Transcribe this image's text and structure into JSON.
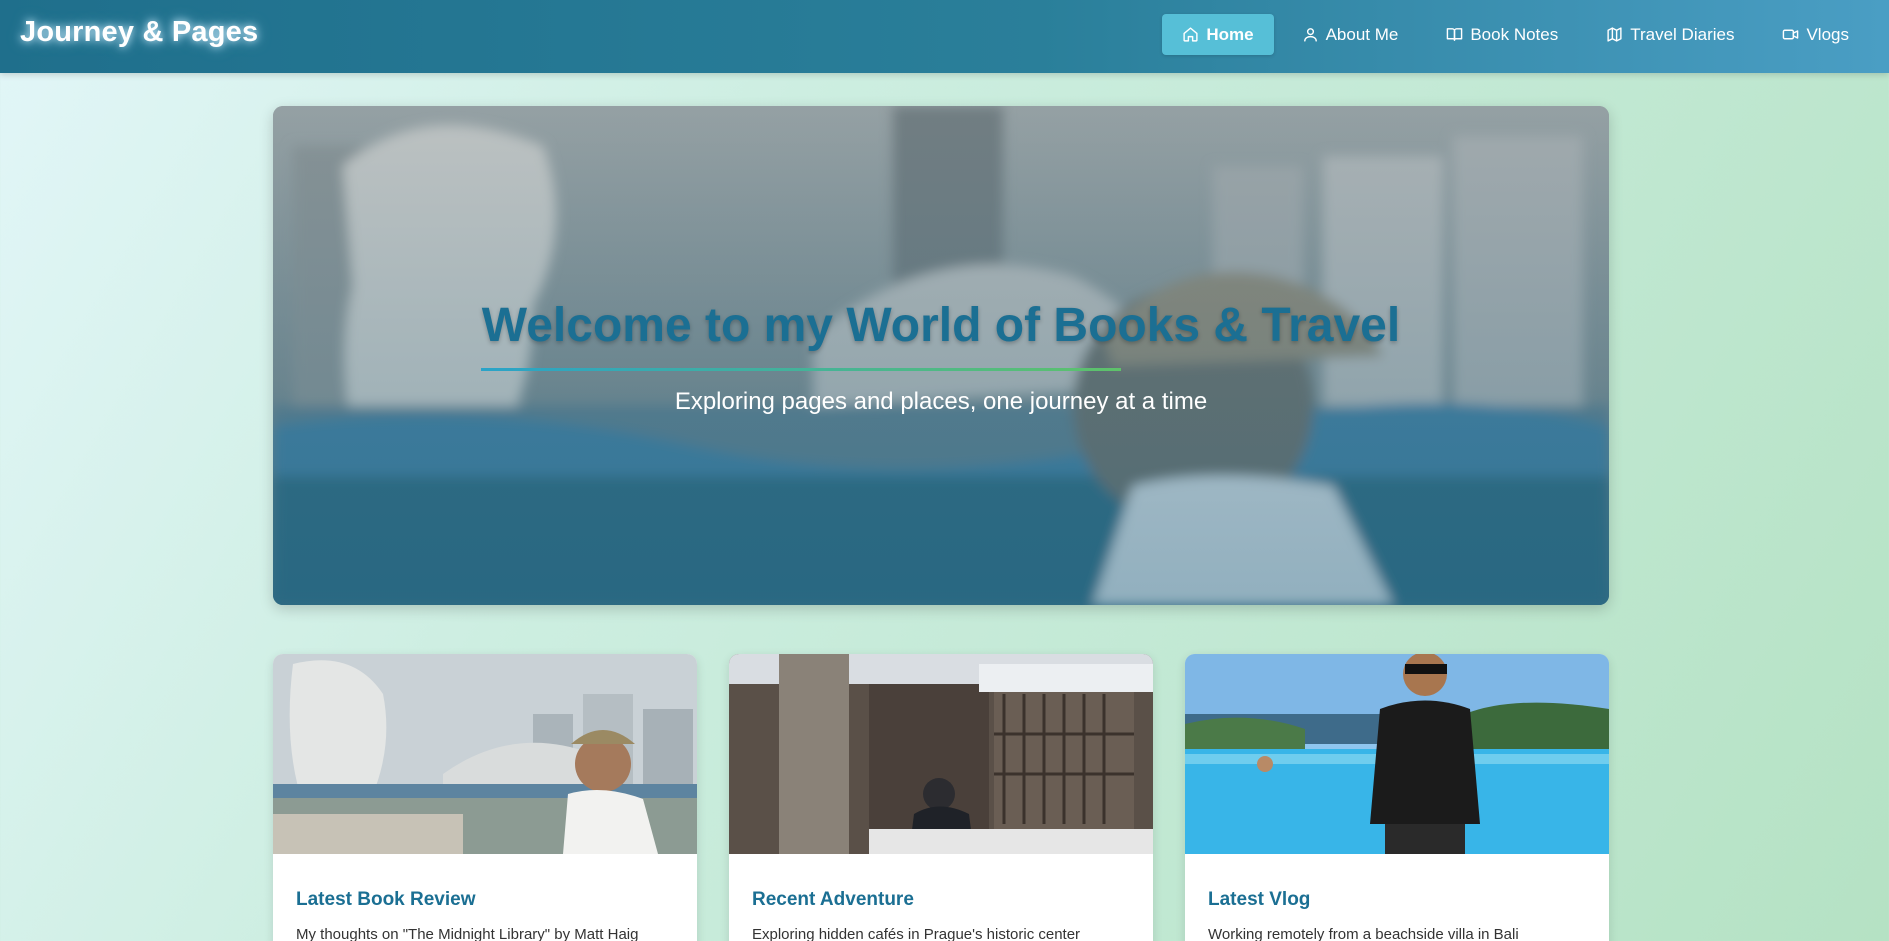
{
  "header": {
    "brand": "Journey & Pages",
    "nav": [
      {
        "label": "Home",
        "icon": "home-icon",
        "active": true
      },
      {
        "label": "About Me",
        "icon": "user-icon",
        "active": false
      },
      {
        "label": "Book Notes",
        "icon": "book-open-icon",
        "active": false
      },
      {
        "label": "Travel Diaries",
        "icon": "map-icon",
        "active": false
      },
      {
        "label": "Vlogs",
        "icon": "video-icon",
        "active": false
      }
    ]
  },
  "hero": {
    "title": "Welcome to my World of Books & Travel",
    "subtitle": "Exploring pages and places, one journey at a time"
  },
  "cards": [
    {
      "title": "Latest Book Review",
      "text": "My thoughts on \"The Midnight Library\" by Matt Haig"
    },
    {
      "title": "Recent Adventure",
      "text": "Exploring hidden cafés in Prague's historic center"
    },
    {
      "title": "Latest Vlog",
      "text": "Working remotely from a beachside villa in Bali"
    }
  ],
  "colors": {
    "header_start": "#1f6f8c",
    "header_end": "#4a9ec4",
    "nav_active": "#56bfd7",
    "accent": "#1b6f93",
    "line_start": "#2aa3c8",
    "line_end": "#5ec26a"
  }
}
